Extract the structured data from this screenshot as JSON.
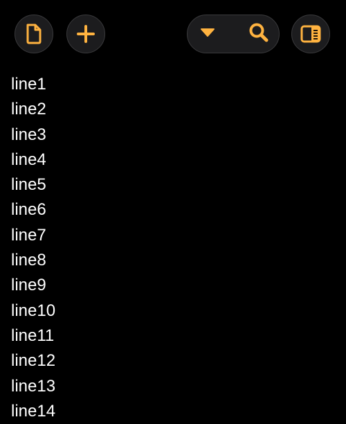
{
  "accent_color": "#FFB340",
  "toolbar": {
    "left_buttons": [
      {
        "icon": "document-icon"
      },
      {
        "icon": "plus-icon"
      }
    ],
    "search_group": {
      "dropdown_icon": "triangle-down-icon",
      "search_icon": "magnifier-icon"
    },
    "right_button": {
      "icon": "sidebar-toggle-icon"
    }
  },
  "editor": {
    "lines": [
      "line1",
      "line2",
      "line3",
      "line4",
      "line5",
      "line6",
      "line7",
      "line8",
      "line9",
      "line10",
      "line11",
      "line12",
      "line13",
      "line14"
    ]
  }
}
